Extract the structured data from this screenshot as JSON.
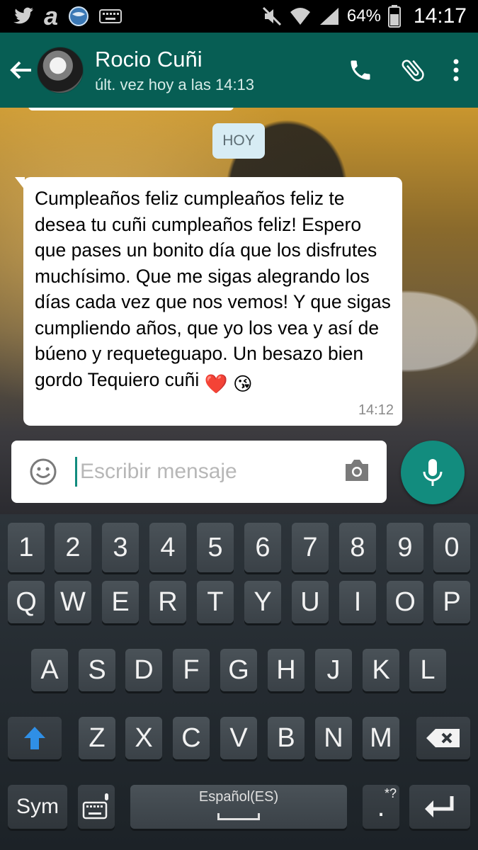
{
  "status_bar": {
    "battery": "64%",
    "time": "14:17",
    "icons": [
      "twitter-icon",
      "amazon-icon",
      "globe-app-icon",
      "keyboard-icon",
      "mute-icon",
      "wifi-icon",
      "signal-icon",
      "battery-icon"
    ]
  },
  "header": {
    "contact_name": "Rocio Cuñi",
    "last_seen": "últ. vez hoy a las 14:13"
  },
  "chat": {
    "date_chip": "HOY",
    "message_text": "Cumpleaños feliz cumpleaños feliz te desea tu cuñi cumpleaños feliz! Espero que pases un bonito día que los disfrutes muchísimo. Que me sigas alegrando los días cada vez que nos vemos! Y que sigas cumpliendo años, que yo los vea y así de búeno y requeteguapo. Un besazo bien gordo Tequiero cuñi",
    "message_emojis": [
      "❤️",
      "😘"
    ],
    "message_time": "14:12"
  },
  "composer": {
    "placeholder": "Escribir mensaje"
  },
  "keyboard": {
    "row1": [
      "1",
      "2",
      "3",
      "4",
      "5",
      "6",
      "7",
      "8",
      "9",
      "0"
    ],
    "row2": [
      "Q",
      "W",
      "E",
      "R",
      "T",
      "Y",
      "U",
      "I",
      "O",
      "P"
    ],
    "row3": [
      "A",
      "S",
      "D",
      "F",
      "G",
      "H",
      "J",
      "K",
      "L"
    ],
    "row4": [
      "Z",
      "X",
      "C",
      "V",
      "B",
      "N",
      "M"
    ],
    "sym_label": "Sym",
    "language_label": "Español(ES)",
    "punct_label": ".",
    "punct_alt": "*?"
  },
  "colors": {
    "app_bar": "#075e54",
    "accent": "#128c7e",
    "date_chip": "#d7ecf4"
  }
}
